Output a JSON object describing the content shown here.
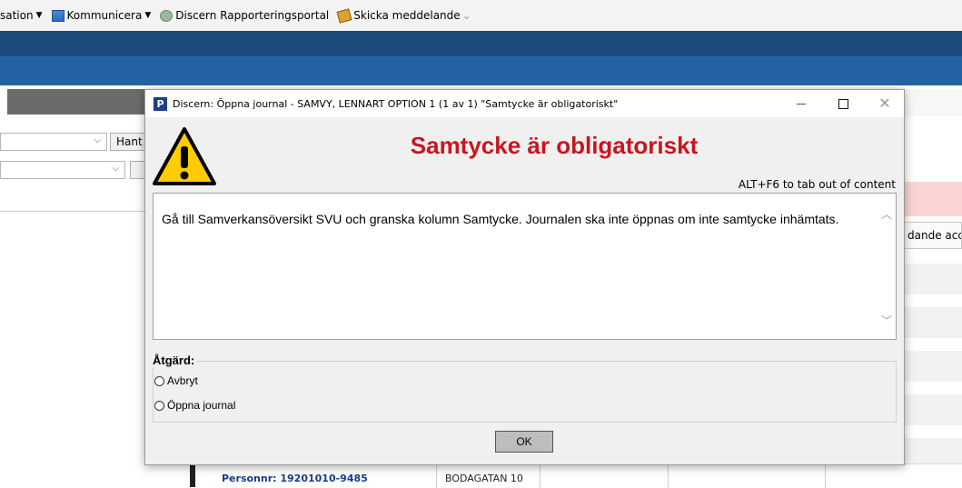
{
  "toolbar": {
    "items": [
      {
        "label": "sation",
        "has_caret": true
      },
      {
        "label": "Kommunicera",
        "has_caret": true
      },
      {
        "label": "Discern Rapporteringsportal"
      },
      {
        "label": "Skicka meddelande"
      }
    ]
  },
  "background": {
    "left_button_label": "Hant",
    "right_button_label": "dande acce",
    "bottom_row_text_1": "Personnr: 19201010-9485",
    "bottom_row_text_2": "BODAGATAN 10"
  },
  "dialog": {
    "app_icon_letter": "P",
    "title": "Discern: Öppna journal - SAMVY, LENNART OPTION 1 (1 av 1) \"Samtycke är obligatoriskt\"",
    "heading": "Samtycke är obligatoriskt",
    "alt_hint": "ALT+F6 to tab out of content",
    "message": "Gå till Samverkansöversikt SVU och granska kolumn Samtycke. Journalen ska inte öppnas om inte samtycke inhämtats.",
    "action_label": "Åtgärd:",
    "options": [
      "Avbryt",
      "Öppna journal"
    ],
    "ok_label": "OK"
  },
  "colors": {
    "heading": "#c8161d",
    "band_dark": "#1c4a7a",
    "band_blue": "#2463a3",
    "warning_yellow": "#ffcc00"
  }
}
